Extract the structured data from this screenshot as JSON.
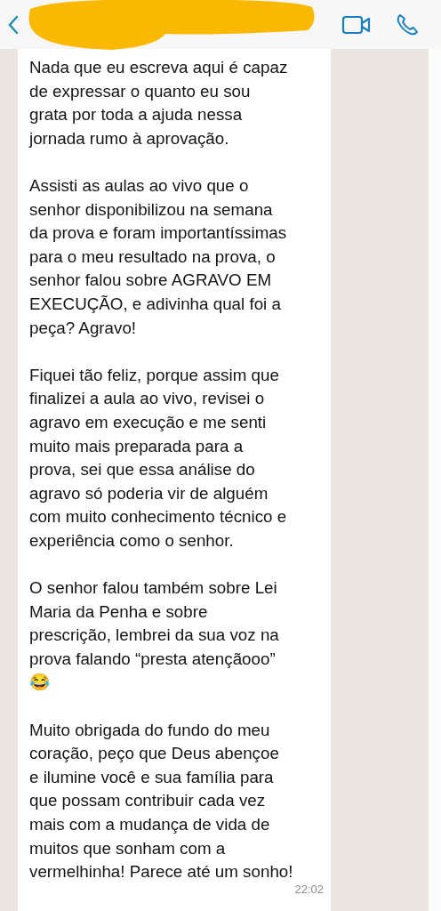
{
  "message": {
    "paragraphs": [
      [
        "Nada que eu escreva aqui é capaz",
        "de expressar o quanto eu sou",
        "grata por toda a ajuda nessa",
        "jornada rumo à aprovação."
      ],
      [
        "Assisti as aulas ao vivo que o",
        "senhor disponibilizou na semana",
        "da prova e foram importantíssimas",
        "para o meu resultado na prova, o",
        "senhor falou sobre AGRAVO EM",
        "EXECUÇÃO, e adivinha qual foi a",
        "peça? Agravo!"
      ],
      [
        "Fiquei tão feliz, porque assim que",
        "finalizei a aula ao vivo, revisei o",
        "agravo em execução e me senti",
        "muito mais preparada para a",
        "prova, sei que essa análise do",
        "agravo só poderia vir de alguém",
        "com muito conhecimento técnico e",
        "experiência como o senhor."
      ],
      [
        "O senhor falou também sobre Lei",
        "Maria da Penha e sobre",
        "prescrição, lembrei da sua voz na",
        "prova falando “presta atençãooo”",
        "😂"
      ],
      [
        "Muito obrigada do fundo do meu",
        "coração, peço que Deus abençoe",
        "e ilumine você e sua família para",
        "que possam contribuir cada vez",
        "mais com a mudança de vida de",
        "muitos que sonham com a",
        "vermelhinha! Parece até um sonho!"
      ]
    ],
    "time": "22:02"
  }
}
